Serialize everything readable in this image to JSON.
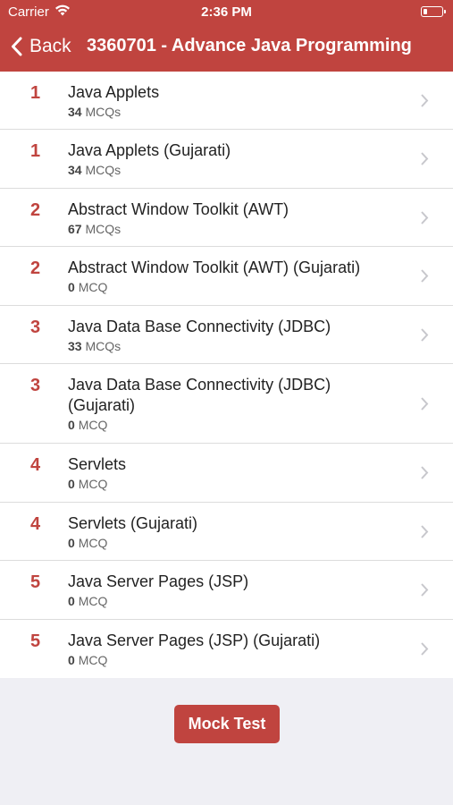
{
  "status_bar": {
    "carrier": "Carrier",
    "time": "2:36 PM"
  },
  "nav": {
    "back_label": "Back",
    "title": "3360701 - Advance Java Programming"
  },
  "items": [
    {
      "num": "1",
      "title": "Java Applets",
      "count": "34",
      "unit": "MCQs"
    },
    {
      "num": "1",
      "title": "Java Applets (Gujarati)",
      "count": "34",
      "unit": "MCQs"
    },
    {
      "num": "2",
      "title": "Abstract Window Toolkit (AWT)",
      "count": "67",
      "unit": "MCQs"
    },
    {
      "num": "2",
      "title": "Abstract Window Toolkit (AWT) (Gujarati)",
      "count": "0",
      "unit": "MCQ"
    },
    {
      "num": "3",
      "title": "Java Data Base Connectivity (JDBC)",
      "count": "33",
      "unit": "MCQs"
    },
    {
      "num": "3",
      "title": "Java Data Base Connectivity (JDBC) (Gujarati)",
      "count": "0",
      "unit": "MCQ"
    },
    {
      "num": "4",
      "title": "Servlets",
      "count": "0",
      "unit": "MCQ"
    },
    {
      "num": "4",
      "title": "Servlets (Gujarati)",
      "count": "0",
      "unit": "MCQ"
    },
    {
      "num": "5",
      "title": "Java Server Pages (JSP)",
      "count": "0",
      "unit": "MCQ"
    },
    {
      "num": "5",
      "title": "Java Server Pages (JSP) (Gujarati)",
      "count": "0",
      "unit": "MCQ"
    }
  ],
  "mock_test_label": "Mock Test",
  "colors": {
    "accent": "#c0443f",
    "background": "#efeff4"
  }
}
